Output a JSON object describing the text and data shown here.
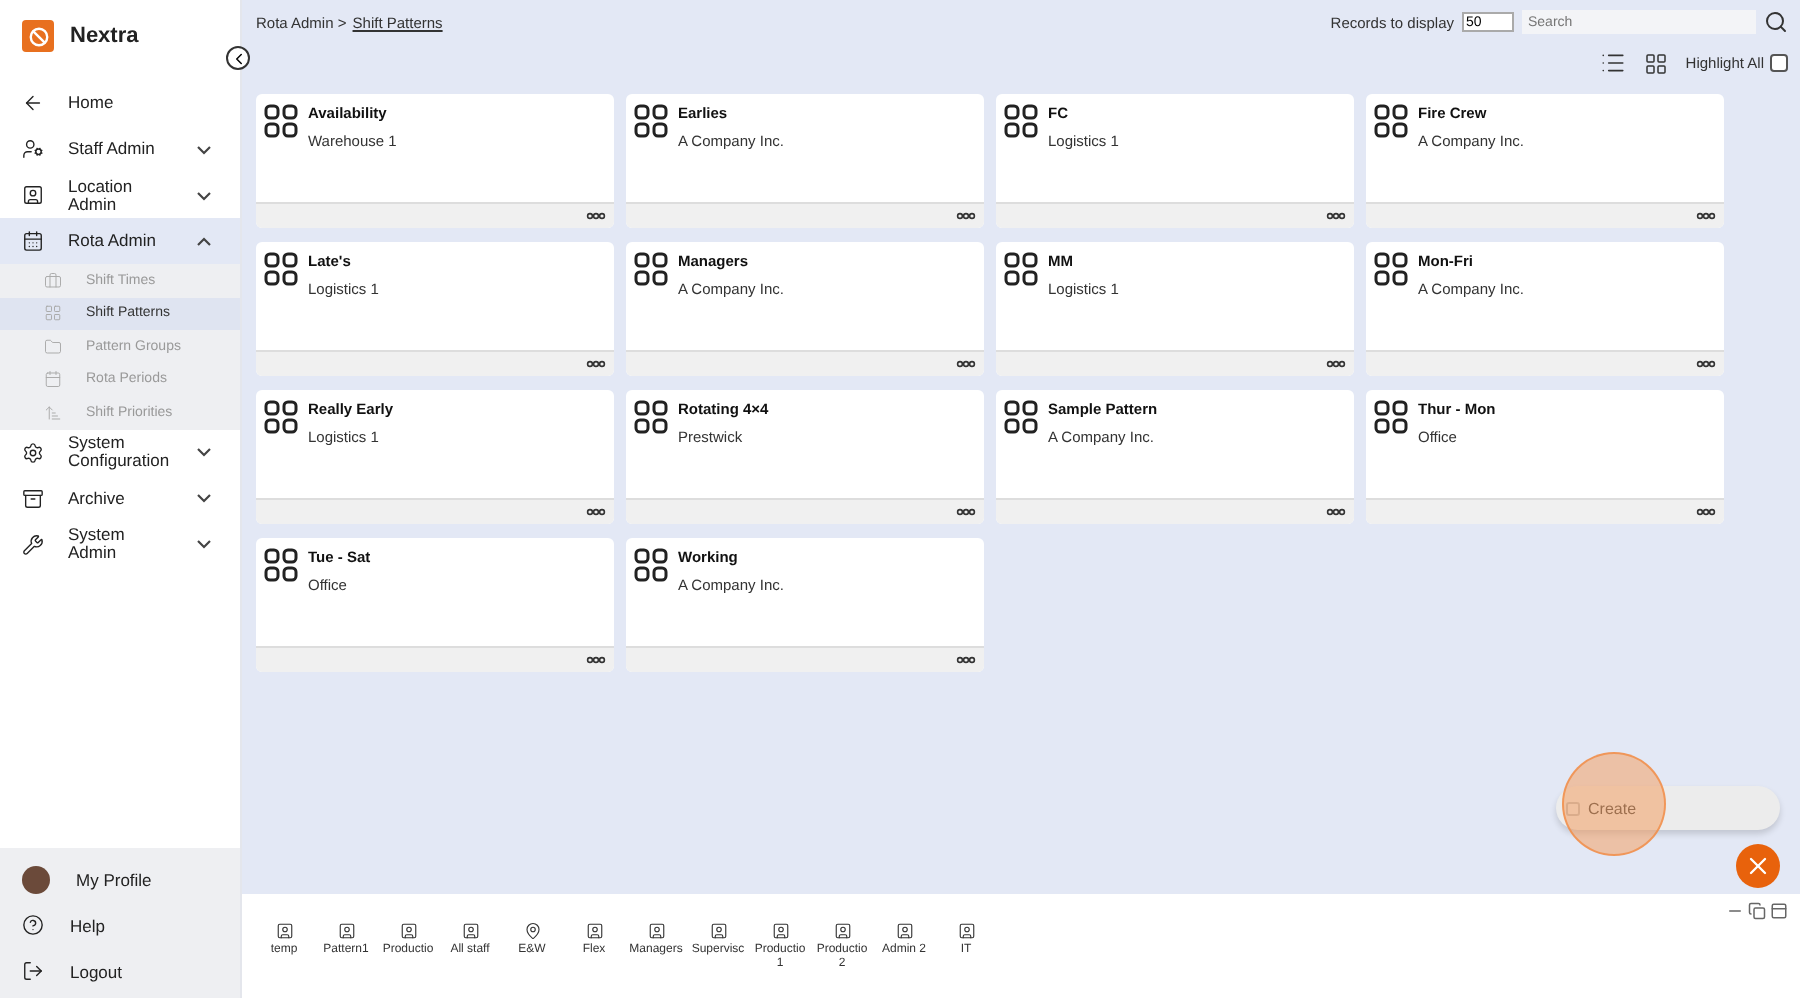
{
  "app": {
    "name": "Nextra"
  },
  "sidebar": {
    "items": [
      {
        "label": "Home",
        "selected": false
      },
      {
        "label": "Staff Admin",
        "expanded": false,
        "selected": false
      },
      {
        "label": "Location Admin",
        "expanded": false,
        "selected": false
      },
      {
        "label": "Rota Admin",
        "expanded": true,
        "selected": true,
        "children": [
          {
            "label": "Shift Times",
            "selected": false
          },
          {
            "label": "Shift Patterns",
            "selected": true
          },
          {
            "label": "Pattern Groups",
            "selected": false
          },
          {
            "label": "Rota Periods",
            "selected": false
          },
          {
            "label": "Shift Priorities",
            "selected": false
          }
        ]
      },
      {
        "label": "System Configuration",
        "expanded": false,
        "selected": false
      },
      {
        "label": "Archive",
        "expanded": false,
        "selected": false
      },
      {
        "label": "System Admin",
        "expanded": false,
        "selected": false
      }
    ],
    "footer": [
      "My Profile",
      "Help",
      "Logout"
    ]
  },
  "breadcrumb": {
    "parent": "Rota Admin",
    "separator": ">",
    "current": "Shift Patterns"
  },
  "toolbar": {
    "records_label": "Records to display",
    "records_value": "50",
    "search_placeholder": "Search",
    "highlight_all": {
      "label": "Highlight All",
      "checked": false
    }
  },
  "cards": [
    {
      "title": "Availability",
      "subtitle": "Warehouse 1"
    },
    {
      "title": "Earlies",
      "subtitle": "A Company Inc."
    },
    {
      "title": "FC",
      "subtitle": "Logistics 1"
    },
    {
      "title": "Fire Crew",
      "subtitle": "A Company Inc."
    },
    {
      "title": "Late's",
      "subtitle": "Logistics 1"
    },
    {
      "title": "Managers",
      "subtitle": "A Company Inc."
    },
    {
      "title": "MM",
      "subtitle": "Logistics 1"
    },
    {
      "title": "Mon-Fri",
      "subtitle": "A Company Inc."
    },
    {
      "title": "Really Early",
      "subtitle": "Logistics 1"
    },
    {
      "title": "Rotating 4×4",
      "subtitle": "Prestwick"
    },
    {
      "title": "Sample Pattern",
      "subtitle": "A Company Inc."
    },
    {
      "title": "Thur - Mon",
      "subtitle": "Office"
    },
    {
      "title": "Tue - Sat",
      "subtitle": "Office"
    },
    {
      "title": "Working",
      "subtitle": "A Company Inc."
    }
  ],
  "create_menu": {
    "label": "Create"
  },
  "taskbar": [
    {
      "label": "temp",
      "kind": "person"
    },
    {
      "label": "Pattern1",
      "kind": "person"
    },
    {
      "label": "Productio",
      "kind": "person"
    },
    {
      "label": "All staff",
      "kind": "person"
    },
    {
      "label": "E&W",
      "kind": "location"
    },
    {
      "label": "Flex",
      "kind": "person"
    },
    {
      "label": "Managers",
      "kind": "person"
    },
    {
      "label": "Supervisc",
      "kind": "person"
    },
    {
      "label": "Productio 1",
      "kind": "person"
    },
    {
      "label": "Productio 2",
      "kind": "person"
    },
    {
      "label": "Admin 2",
      "kind": "person"
    },
    {
      "label": "IT",
      "kind": "person"
    }
  ]
}
